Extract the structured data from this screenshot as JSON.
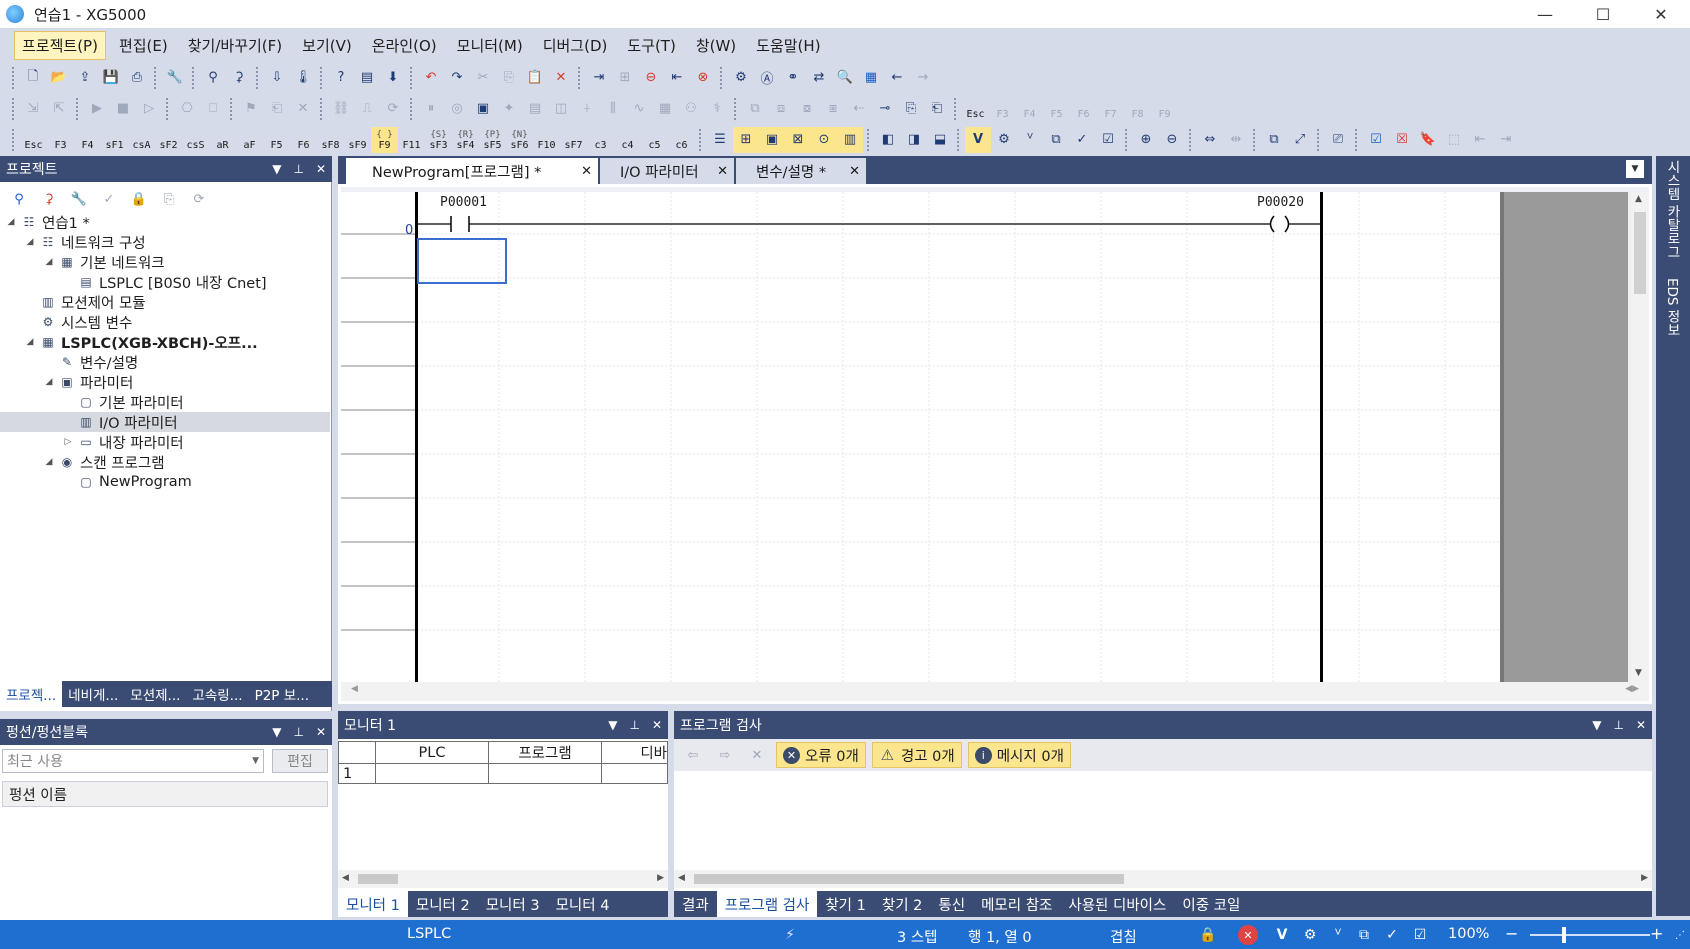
{
  "window": {
    "title": "연습1 - XG5000",
    "minimize": "—",
    "maximize": "☐",
    "close": "✕"
  },
  "menu": [
    "프로젝트(P)",
    "편집(E)",
    "찾기/바꾸기(F)",
    "보기(V)",
    "온라인(O)",
    "모니터(M)",
    "디버그(D)",
    "도구(T)",
    "창(W)",
    "도움말(H)"
  ],
  "toolbar3_keys": [
    {
      "sym": "",
      "key": "Esc"
    },
    {
      "sym": "",
      "key": "F3"
    },
    {
      "sym": "",
      "key": "F4"
    },
    {
      "sym": "",
      "key": "sF1"
    },
    {
      "sym": "",
      "key": "csA"
    },
    {
      "sym": "",
      "key": "sF2"
    },
    {
      "sym": "",
      "key": "csS"
    },
    {
      "sym": "",
      "key": "aR"
    },
    {
      "sym": "",
      "key": "aF"
    },
    {
      "sym": "",
      "key": "F5"
    },
    {
      "sym": "",
      "key": "F6"
    },
    {
      "sym": "",
      "key": "sF8"
    },
    {
      "sym": "",
      "key": "sF9"
    },
    {
      "sym": "{ }",
      "key": "F9"
    },
    {
      "sym": "",
      "key": "F11"
    },
    {
      "sym": "{S}",
      "key": "sF3"
    },
    {
      "sym": "{R}",
      "key": "sF4"
    },
    {
      "sym": "{P}",
      "key": "sF5"
    },
    {
      "sym": "{N}",
      "key": "sF6"
    },
    {
      "sym": "",
      "key": "F10"
    },
    {
      "sym": "",
      "key": "sF7"
    },
    {
      "sym": "",
      "key": "c3"
    },
    {
      "sym": "",
      "key": "c4"
    },
    {
      "sym": "",
      "key": "c5"
    },
    {
      "sym": "",
      "key": "c6"
    }
  ],
  "toolbar2_fkeys": [
    "Esc",
    "F3",
    "F4",
    "F5",
    "F6",
    "F7",
    "F8",
    "F9"
  ],
  "project_panel": {
    "title": "프로젝트",
    "tree": [
      {
        "label": "연습1 *",
        "level": 0,
        "exp": "◢",
        "icon": "☷"
      },
      {
        "label": "네트워크 구성",
        "level": 1,
        "exp": "◢",
        "icon": "☷"
      },
      {
        "label": "기본 네트워크",
        "level": 2,
        "exp": "◢",
        "icon": "▦"
      },
      {
        "label": "LSPLC [B0S0 내장 Cnet]",
        "level": 3,
        "exp": "",
        "icon": "▤"
      },
      {
        "label": "모션제어 모듈",
        "level": 1,
        "exp": "",
        "icon": "▥"
      },
      {
        "label": "시스템 변수",
        "level": 1,
        "exp": "",
        "icon": "⚙"
      },
      {
        "label": "LSPLC(XGB-XBCH)-오프...",
        "level": 1,
        "exp": "◢",
        "icon": "▦",
        "bold": true
      },
      {
        "label": "변수/설명",
        "level": 2,
        "exp": "",
        "icon": "✎"
      },
      {
        "label": "파라미터",
        "level": 2,
        "exp": "◢",
        "icon": "▣"
      },
      {
        "label": "기본 파라미터",
        "level": 3,
        "exp": "",
        "icon": "▢"
      },
      {
        "label": "I/O 파라미터",
        "level": 3,
        "exp": "",
        "icon": "▥",
        "selected": true
      },
      {
        "label": "내장 파라미터",
        "level": 3,
        "exp": "▷",
        "icon": "▭"
      },
      {
        "label": "스캔 프로그램",
        "level": 2,
        "exp": "◢",
        "icon": "◉"
      },
      {
        "label": "NewProgram",
        "level": 3,
        "exp": "",
        "icon": "▢"
      }
    ],
    "tabs": [
      "프로젝...",
      "네비게...",
      "모션제...",
      "고속링...",
      "P2P 보..."
    ]
  },
  "function_panel": {
    "title": "펑션/펑션블록",
    "combo_placeholder": "최근 사용",
    "edit_button": "편집",
    "column_header": "펑션 이름"
  },
  "editor": {
    "tabs": [
      {
        "label": "NewProgram[프로그램] *",
        "active": true
      },
      {
        "label": "I/O 파라미터",
        "active": false
      },
      {
        "label": "변수/설명 *",
        "active": false
      }
    ],
    "rung_number": "0",
    "contact_label": "P00001",
    "coil_label": "P00020"
  },
  "side_tabs": [
    "시스템 카탈로그",
    "EDS 정보"
  ],
  "monitor_panel": {
    "title": "모니터 1",
    "columns": [
      "PLC",
      "프로그램",
      "디바"
    ],
    "rows": [
      [
        "1",
        "",
        "",
        ""
      ]
    ],
    "tabs": [
      "모니터 1",
      "모니터 2",
      "모니터 3",
      "모니터 4"
    ]
  },
  "check_panel": {
    "title": "프로그램 검사",
    "errors": "오류 0개",
    "warnings": "경고 0개",
    "messages": "메시지 0개",
    "tabs": [
      "결과",
      "프로그램 검사",
      "찾기 1",
      "찾기 2",
      "통신",
      "메모리 참조",
      "사용된 디바이스",
      "이중 코일"
    ]
  },
  "status_bar": {
    "plc": "LSPLC",
    "steps": "3 스텝",
    "position": "행 1, 열 0",
    "mode": "겹침",
    "zoom": "100%",
    "zoom_minus": "−",
    "zoom_plus": "+"
  },
  "colors": {
    "panel_header": "#3b4c74",
    "status_bar": "#1f6fd1",
    "highlight": "#fbe68e",
    "cursor_border": "#3a6fd0"
  }
}
